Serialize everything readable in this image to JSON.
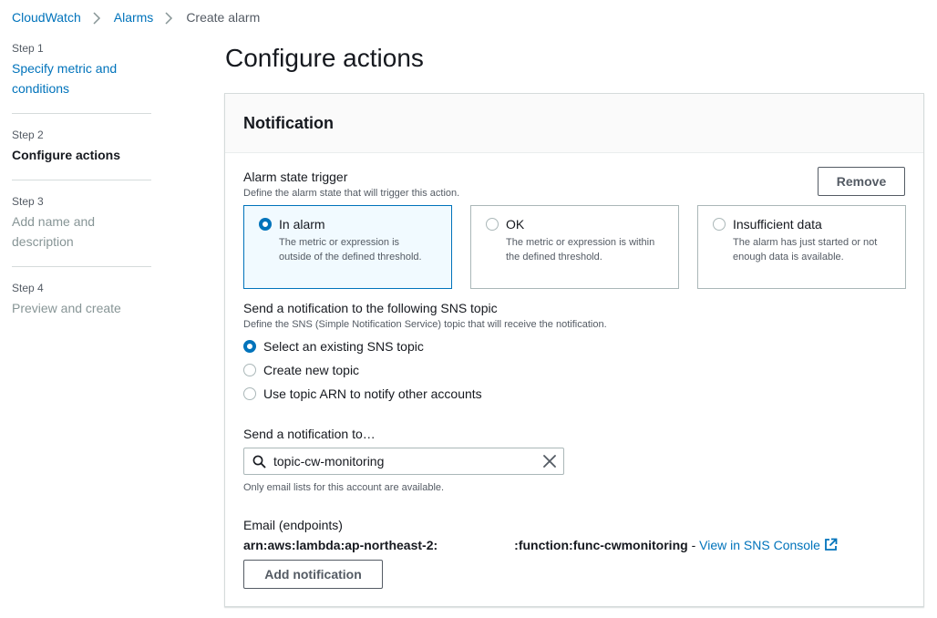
{
  "breadcrumb": {
    "item1": "CloudWatch",
    "item2": "Alarms",
    "current": "Create alarm"
  },
  "steps": [
    {
      "num": "Step 1",
      "title": "Specify metric and conditions"
    },
    {
      "num": "Step 2",
      "title": "Configure actions"
    },
    {
      "num": "Step 3",
      "title": "Add name and description"
    },
    {
      "num": "Step 4",
      "title": "Preview and create"
    }
  ],
  "page_title": "Configure actions",
  "notification": {
    "heading": "Notification",
    "remove_label": "Remove",
    "trigger": {
      "label": "Alarm state trigger",
      "desc": "Define the alarm state that will trigger this action.",
      "options": [
        {
          "title": "In alarm",
          "desc": "The metric or expression is outside of the defined threshold."
        },
        {
          "title": "OK",
          "desc": "The metric or expression is within the defined threshold."
        },
        {
          "title": "Insufficient data",
          "desc": "The alarm has just started or not enough data is available."
        }
      ]
    },
    "sns": {
      "label": "Send a notification to the following SNS topic",
      "desc": "Define the SNS (Simple Notification Service) topic that will receive the notification.",
      "options": [
        {
          "label": "Select an existing SNS topic"
        },
        {
          "label": "Create new topic"
        },
        {
          "label": "Use topic ARN to notify other accounts"
        }
      ]
    },
    "send_to": {
      "label": "Send a notification to…",
      "value": "topic-cw-monitoring",
      "hint": "Only email lists for this account are available."
    },
    "endpoints": {
      "label": "Email (endpoints)",
      "arn_prefix": "arn:aws:lambda:ap-northeast-2:",
      "arn_suffix": ":function:func-cwmonitoring",
      "separator": " - ",
      "link": "View in SNS Console"
    },
    "add_label": "Add notification"
  },
  "colors": {
    "accent": "#0073bb",
    "text": "#16191f",
    "muted": "#545b64",
    "border": "#aab7b8"
  }
}
